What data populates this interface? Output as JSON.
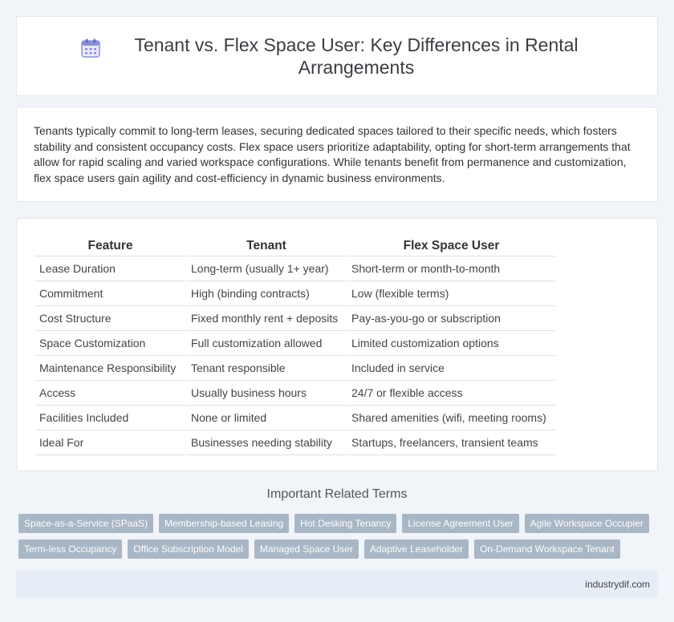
{
  "header": {
    "title": "Tenant vs. Flex Space User: Key Differences in Rental Arrangements",
    "icon": "calendar-icon"
  },
  "summary": "Tenants typically commit to long-term leases, securing dedicated spaces tailored to their specific needs, which fosters stability and consistent occupancy costs. Flex space users prioritize adaptability, opting for short-term arrangements that allow for rapid scaling and varied workspace configurations. While tenants benefit from permanence and customization, flex space users gain agility and cost-efficiency in dynamic business environments.",
  "table": {
    "headers": [
      "Feature",
      "Tenant",
      "Flex Space User"
    ],
    "rows": [
      [
        "Lease Duration",
        "Long-term (usually 1+ year)",
        "Short-term or month-to-month"
      ],
      [
        "Commitment",
        "High (binding contracts)",
        "Low (flexible terms)"
      ],
      [
        "Cost Structure",
        "Fixed monthly rent + deposits",
        "Pay-as-you-go or subscription"
      ],
      [
        "Space Customization",
        "Full customization allowed",
        "Limited customization options"
      ],
      [
        "Maintenance Responsibility",
        "Tenant responsible",
        "Included in service"
      ],
      [
        "Access",
        "Usually business hours",
        "24/7 or flexible access"
      ],
      [
        "Facilities Included",
        "None or limited",
        "Shared amenities (wifi, meeting rooms)"
      ],
      [
        "Ideal For",
        "Businesses needing stability",
        "Startups, freelancers, transient teams"
      ]
    ]
  },
  "related": {
    "title": "Important Related Terms",
    "tags": [
      "Space-as-a-Service (SPaaS)",
      "Membership-based Leasing",
      "Hot Desking Tenancy",
      "License Agreement User",
      "Agile Workspace Occupier",
      "Term-less Occupancy",
      "Office Subscription Model",
      "Managed Space User",
      "Adaptive Leaseholder",
      "On-Demand Workspace Tenant"
    ]
  },
  "footer": {
    "site": "industrydif.com"
  },
  "colors": {
    "background": "#f1f4f9",
    "tag": "#a9b6c6",
    "footer": "#e6edf7",
    "icon": "#8a8fd8"
  }
}
